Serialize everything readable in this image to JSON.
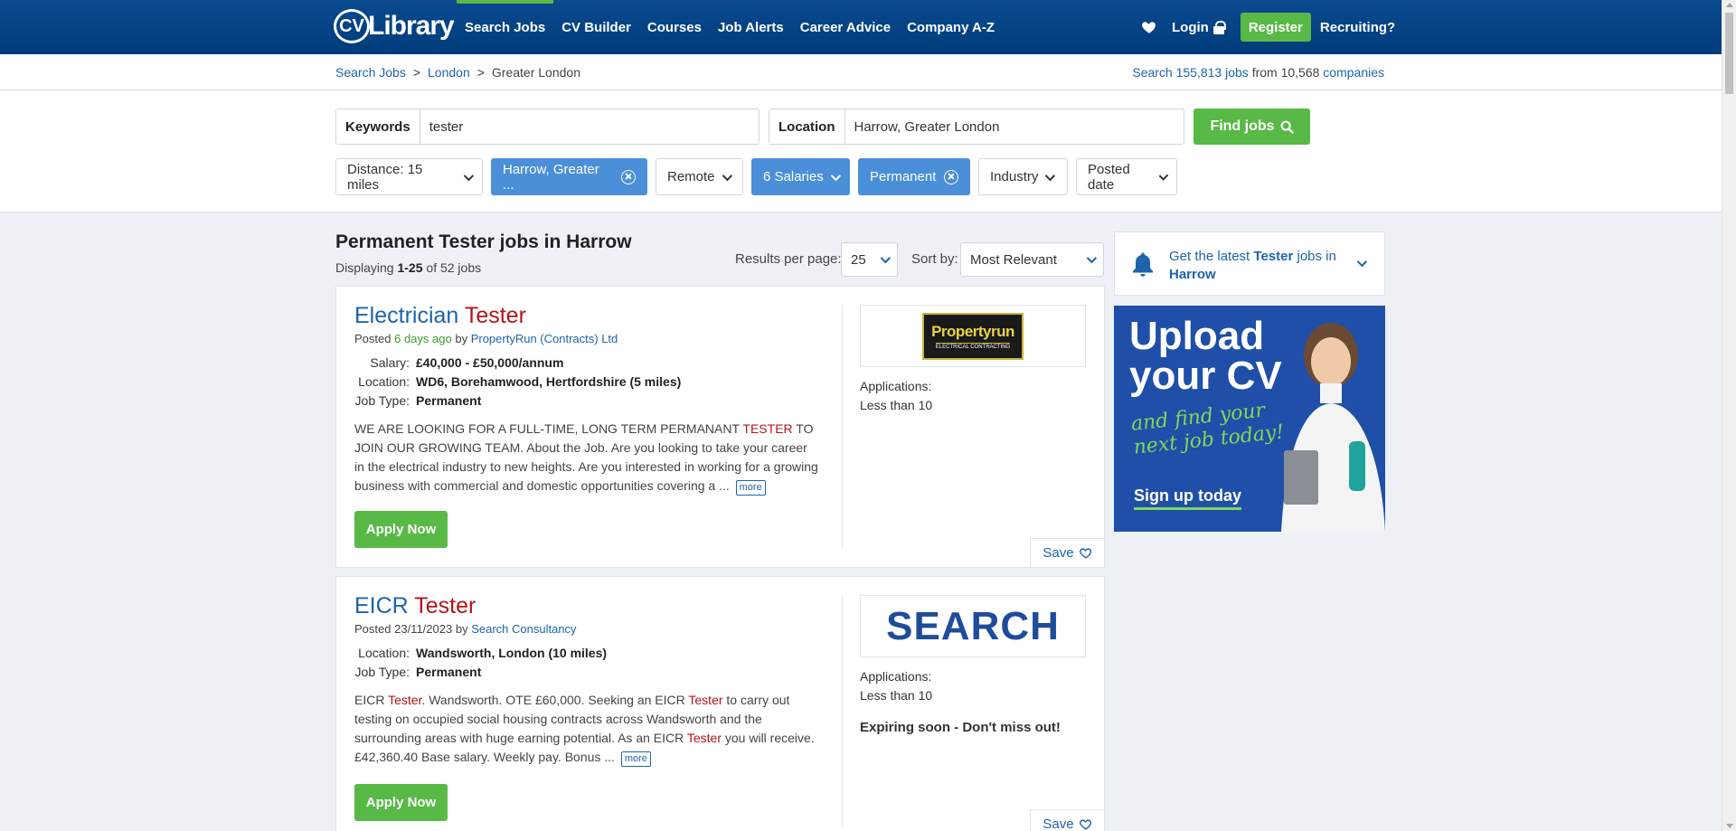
{
  "header": {
    "logo_cv": "CV",
    "logo_text": "Library",
    "nav": [
      "Search Jobs",
      "CV Builder",
      "Courses",
      "Job Alerts",
      "Career Advice",
      "Company A-Z"
    ],
    "login": "Login",
    "register": "Register",
    "recruiting": "Recruiting?"
  },
  "breadcrumb": {
    "items": [
      "Search Jobs",
      "London",
      "Greater London"
    ],
    "sep": ">",
    "stats_prefix": "Search",
    "stats_jobs": "155,813 jobs",
    "stats_from": "from",
    "stats_companies_num": "10,568",
    "stats_companies": "companies"
  },
  "search": {
    "keywords_label": "Keywords",
    "keywords_value": "tester",
    "location_label": "Location",
    "location_value": "Harrow, Greater London",
    "find_label": "Find jobs"
  },
  "filters": [
    {
      "label": "Distance: 15 miles",
      "type": "dropdown"
    },
    {
      "label": "Harrow, Greater ...",
      "type": "active-remove"
    },
    {
      "label": "Remote",
      "type": "dropdown"
    },
    {
      "label": "6 Salaries",
      "type": "active-dropdown"
    },
    {
      "label": "Permanent",
      "type": "active-remove"
    },
    {
      "label": "Industry",
      "type": "dropdown"
    },
    {
      "label": "Posted date",
      "type": "dropdown"
    }
  ],
  "results": {
    "title": "Permanent Tester jobs in Harrow",
    "displaying_prefix": "Displaying",
    "range": "1-25",
    "of_text": "of 52 jobs",
    "rpp_label": "Results per page:",
    "rpp_value": "25",
    "sort_label": "Sort by:",
    "sort_value": "Most Relevant"
  },
  "jobs": [
    {
      "title_a": "Electrician",
      "title_b": "Tester",
      "posted_prefix": "Posted",
      "posted_date": "6 days ago",
      "by": "by",
      "company": "PropertyRun (Contracts) Ltd",
      "salary_label": "Salary:",
      "salary": "£40,000 - £50,000/annum",
      "location_label": "Location:",
      "location": "WD6, Borehamwood, Hertfordshire (5 miles)",
      "jobtype_label": "Job Type:",
      "jobtype": "Permanent",
      "desc_a": "WE ARE LOOKING FOR A FULL-TIME, LONG TERM PERMANANT ",
      "desc_hl": "TESTER",
      "desc_b": " TO JOIN OUR GROWING TEAM. About the Job. Are you looking to take your career in the electrical industry to new heights. Are you interested in working for a growing business with commercial and domestic opportunities covering a ...",
      "more": "more",
      "apply": "Apply Now",
      "logo_text": "Propertyrun",
      "logo_sub": "ELECTRICAL CONTRACTING",
      "applications_label": "Applications:",
      "applications_value": "Less than 10",
      "save": "Save"
    },
    {
      "title_a": "EICR",
      "title_b": "Tester",
      "posted_prefix": "Posted",
      "posted_date": "23/11/2023",
      "by": "by",
      "company": "Search Consultancy",
      "location_label": "Location:",
      "location": "Wandsworth, London (10 miles)",
      "jobtype_label": "Job Type:",
      "jobtype": "Permanent",
      "desc_1": "EICR ",
      "desc_hl1": "Tester",
      "desc_2": ". Wandsworth. OTE £60,000. Seeking an EICR ",
      "desc_hl2": "Tester",
      "desc_3": " to carry out testing on occupied social housing contracts across Wandsworth and the surrounding areas with huge earning potential. As an EICR ",
      "desc_hl3": "Tester",
      "desc_4": " you will receive. £42,360.40 Base salary. Weekly pay. Bonus ...",
      "more": "more",
      "apply": "Apply Now",
      "logo_text": "SEARCH",
      "applications_label": "Applications:",
      "applications_value": "Less than 10",
      "expiring": "Expiring soon - Don't miss out!",
      "save": "Save"
    }
  ],
  "sidebar": {
    "alert_a": "Get the latest ",
    "alert_b": "Tester",
    "alert_c": " jobs in ",
    "alert_d": "Harrow",
    "banner_h1": "Upload your CV",
    "banner_h2": "and find your next job today!",
    "banner_cta": "Sign up today"
  },
  "colors": {
    "header": "#003c7b",
    "green": "#58b947",
    "link": "#1e64aa",
    "highlight": "#b3141b",
    "chip_active": "#4a8fd8"
  }
}
